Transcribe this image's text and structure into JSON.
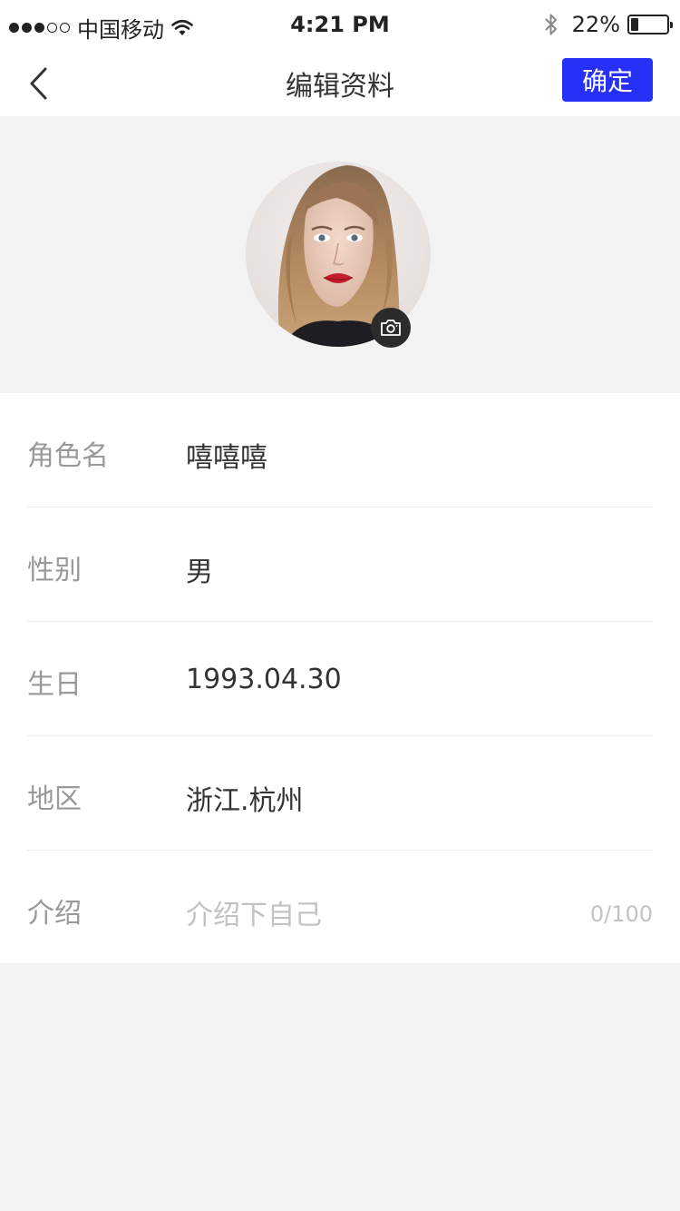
{
  "status_bar": {
    "carrier": "中国移动",
    "time": "4:21 PM",
    "battery_percent": "22%",
    "battery_level": 0.22,
    "signal_strength": 3
  },
  "nav": {
    "title": "编辑资料",
    "confirm_label": "确定",
    "back_icon": "chevron-left-icon"
  },
  "avatar": {
    "camera_icon": "camera-icon"
  },
  "form": {
    "name": {
      "label": "角色名",
      "value": "嘻嘻嘻"
    },
    "gender": {
      "label": "性别",
      "value": "男"
    },
    "birthday": {
      "label": "生日",
      "value": "1993.04.30"
    },
    "region": {
      "label": "地区",
      "value": "浙江.杭州"
    },
    "intro": {
      "label": "介绍",
      "placeholder": "介绍下自己",
      "count": "0/100"
    }
  },
  "colors": {
    "accent": "#2630f7",
    "background": "#f3f3f3",
    "label": "#999999",
    "value": "#333333",
    "placeholder": "#c2c2c2"
  }
}
